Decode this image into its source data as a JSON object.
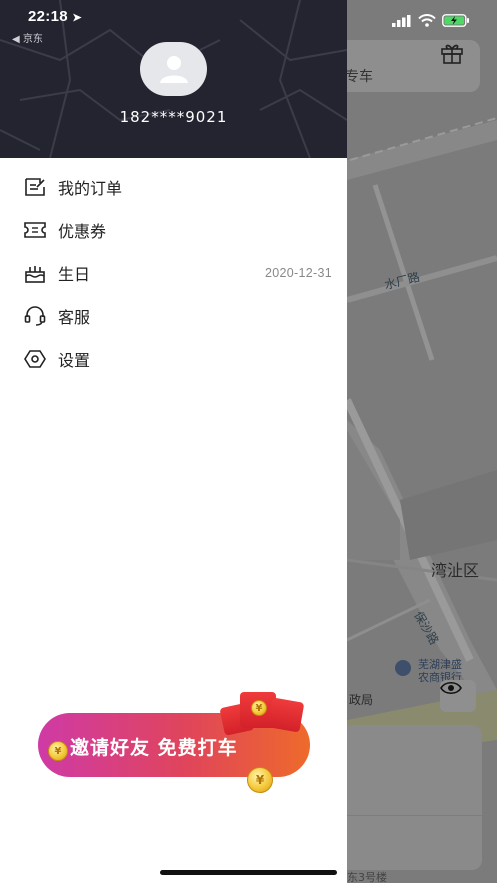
{
  "status_bar": {
    "time": "22:18",
    "back_app": "◀ 京东"
  },
  "map": {
    "top_card_text": "专车",
    "road_1": "水厂路",
    "district": "湾沚区",
    "road_2": "保沙路",
    "poi_bank_line1": "芜湖津盛",
    "poi_bank_line2": "农商银行",
    "poi_gov": "政局",
    "poi_bottom": "东3号楼"
  },
  "drawer": {
    "phone": "182****9021",
    "menu": [
      {
        "label": "我的订单",
        "icon": "orders-icon",
        "value": ""
      },
      {
        "label": "优惠券",
        "icon": "coupon-icon",
        "value": ""
      },
      {
        "label": "生日",
        "icon": "birthday-cake-icon",
        "value": "2020-12-31"
      },
      {
        "label": "客服",
        "icon": "headset-icon",
        "value": ""
      },
      {
        "label": "设置",
        "icon": "settings-icon",
        "value": ""
      }
    ],
    "invite_banner": "邀请好友 免费打车",
    "coin_symbol": "¥"
  },
  "colors": {
    "header_bg": "#23242f",
    "banner_gradient_start": "#cf3aa6",
    "banner_gradient_end": "#ee6a2b"
  }
}
